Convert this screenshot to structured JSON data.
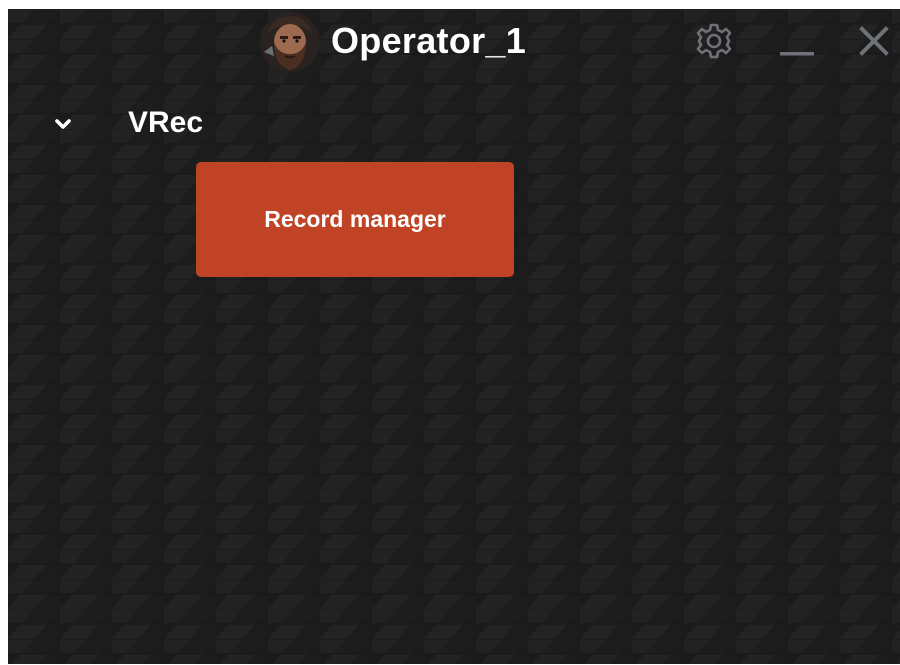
{
  "window": {
    "title": "Operator_1",
    "avatar_icon": "bearded-warrior-avatar",
    "settings_icon": "gear-icon",
    "minimize_icon": "minimize-icon",
    "close_icon": "close-icon",
    "background_color": "#1a1a1a",
    "text_color": "#ffffff",
    "titlebar_icon_color": "#6e7177"
  },
  "section": {
    "title": "VRec",
    "chevron_icon": "chevron-down-icon",
    "expanded": true
  },
  "actions": {
    "record_manager_label": "Record manager",
    "button_color": "#bf4324"
  }
}
